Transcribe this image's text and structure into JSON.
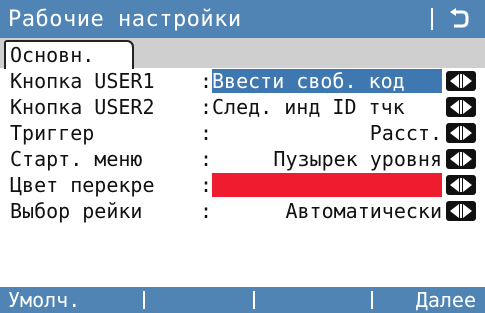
{
  "header": {
    "title": "Рабочие настройки",
    "back_icon": "return-arrow-icon"
  },
  "tabs": [
    {
      "label": "Основн.",
      "active": true
    }
  ],
  "settings": [
    {
      "label": "Кнопка USER1",
      "colon": ":",
      "value": "Ввести своб. код",
      "state": "focused",
      "align": "left"
    },
    {
      "label": "Кнопка USER2",
      "colon": ":",
      "value": "След. инд ID тчк",
      "state": "normal",
      "align": "left"
    },
    {
      "label": "Триггер",
      "colon": ":",
      "value": "Расст.",
      "state": "normal",
      "align": "right"
    },
    {
      "label": "Старт. меню",
      "colon": ":",
      "value": "Пузырек уровня",
      "state": "normal",
      "align": "right"
    },
    {
      "label": "Цвет перекре",
      "colon": ":",
      "value": "",
      "state": "color",
      "color": "#ee1c2e",
      "align": "left"
    },
    {
      "label": "Выбор рейки",
      "colon": ":",
      "value": "Автоматически",
      "state": "normal",
      "align": "right"
    }
  ],
  "softkeys": {
    "f1": "Умолч.",
    "f2": "",
    "f3": "",
    "f4": "Далее"
  },
  "colors": {
    "accent": "#4f84b5",
    "focus": "#3f78b0",
    "tab_strip": "#cfcfcf"
  }
}
